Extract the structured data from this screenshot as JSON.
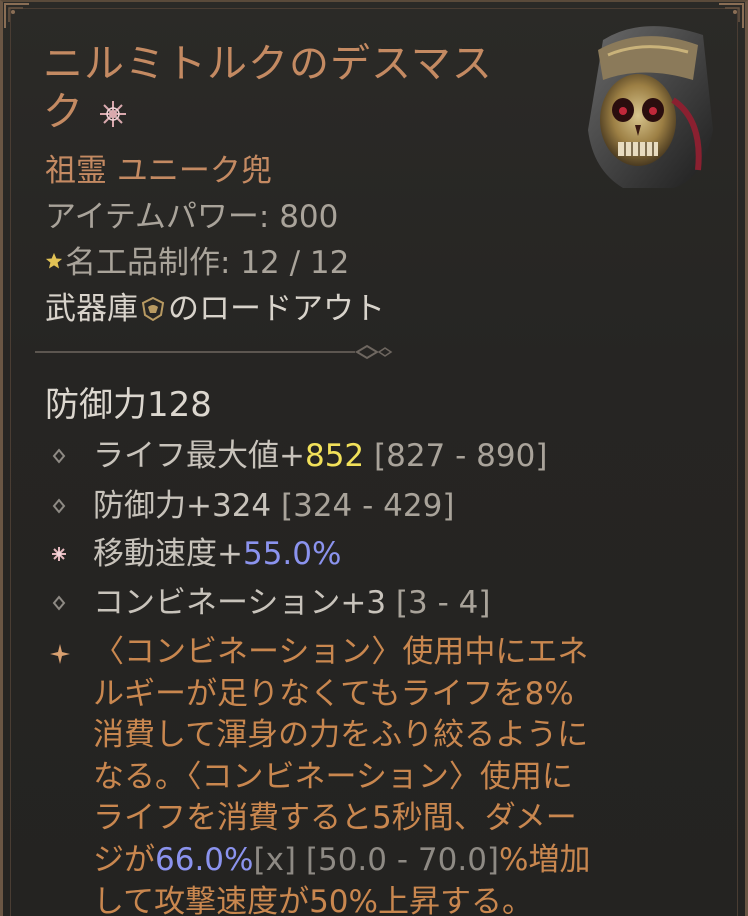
{
  "item": {
    "name": "ニルミトルクのデスマスク",
    "type": "祖霊 ユニーク兜",
    "item_power_label": "アイテムパワー: ",
    "item_power_value": "800",
    "masterwork_label": "名工品制作: ",
    "masterwork_value": "12 / 12",
    "loadout_prefix": "武器庫",
    "loadout_suffix": "のロードアウト",
    "armor_label": "防御力",
    "armor_value": "128"
  },
  "affixes": [
    {
      "label": "ライフ最大値+",
      "value": "852",
      "range": " [827 - 890]"
    },
    {
      "label": "防御力+324",
      "value": "",
      "range": " [324 - 429]"
    },
    {
      "label": "移動速度+",
      "value": "55.0%",
      "range": ""
    },
    {
      "label": "コンビネーション+3",
      "value": "",
      "range": " [3 - 4]"
    }
  ],
  "aspect": {
    "line1": "〈コンビネーション〉使用中にエネ",
    "line2": "ルギーが足りなくてもライフを8%",
    "line3": "消費して渾身の力をふり絞るように",
    "line4": "なる。〈コンビネーション〉使用に",
    "line5": "ライフを消費すると5秒間、ダメー",
    "line6_prefix": "ジが",
    "line6_value": "66.0%",
    "line6_x": "[x]",
    "line6_range": " [50.0 - 70.0]",
    "line6_suffix": "%増加",
    "line7": "して攻撃速度が50%上昇する。"
  },
  "colors": {
    "title": "#c48a62",
    "greater_affix_yellow": "#f2e15a",
    "max_roll_blue": "#8b93ee",
    "aspect_orange": "#c9874f"
  },
  "icons": [
    "mythic-glyph-icon",
    "helm-icon",
    "star-icon",
    "loadout-icon",
    "diamond-bullet-icon",
    "flower-bullet-icon",
    "sparkle-bullet-icon"
  ]
}
